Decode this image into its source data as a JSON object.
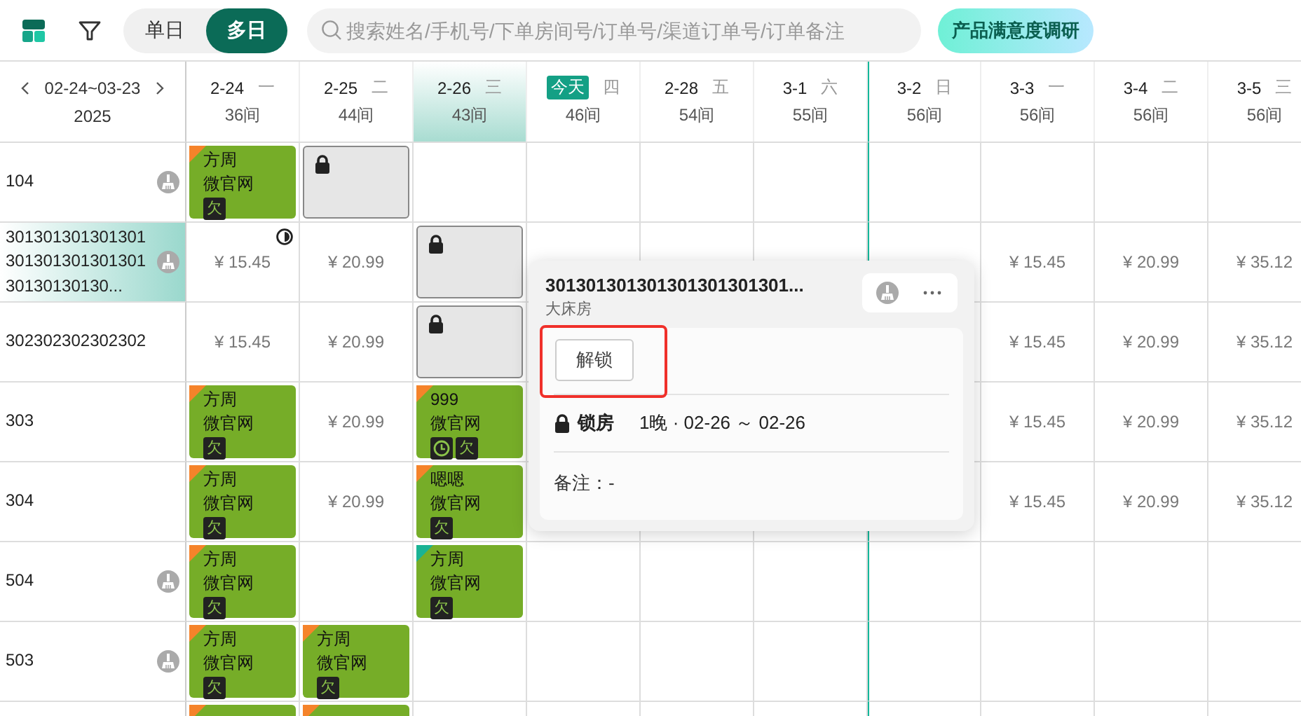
{
  "toolbar": {
    "view_modes": [
      {
        "label": "单日",
        "selected": false
      },
      {
        "label": "多日",
        "selected": true
      }
    ],
    "search": {
      "placeholder": "搜索姓名/手机号/下单房间号/订单号/渠道订单号/订单备注"
    },
    "survey_button": "产品满意度调研"
  },
  "date_range": {
    "range": "02-24~03-23",
    "year": "2025"
  },
  "dates": [
    {
      "date": "2-24",
      "weekday": "一",
      "count": "36间",
      "selected": false,
      "today": false,
      "marked": false
    },
    {
      "date": "2-25",
      "weekday": "二",
      "count": "44间",
      "selected": false,
      "today": false,
      "marked": false
    },
    {
      "date": "2-26",
      "weekday": "三",
      "count": "43间",
      "selected": true,
      "today": false,
      "marked": false
    },
    {
      "date": "今天",
      "weekday": "四",
      "count": "46间",
      "selected": false,
      "today": true,
      "marked": false
    },
    {
      "date": "2-28",
      "weekday": "五",
      "count": "54间",
      "selected": false,
      "today": false,
      "marked": false
    },
    {
      "date": "3-1",
      "weekday": "六",
      "count": "55间",
      "selected": false,
      "today": false,
      "marked": false
    },
    {
      "date": "3-2",
      "weekday": "日",
      "count": "56间",
      "selected": false,
      "today": false,
      "marked": true
    },
    {
      "date": "3-3",
      "weekday": "一",
      "count": "56间",
      "selected": false,
      "today": false,
      "marked": false
    },
    {
      "date": "3-4",
      "weekday": "二",
      "count": "56间",
      "selected": false,
      "today": false,
      "marked": false
    },
    {
      "date": "3-5",
      "weekday": "三",
      "count": "56间",
      "selected": false,
      "today": false,
      "marked": false
    }
  ],
  "rooms": [
    {
      "name": "104",
      "needs_cleaning": true,
      "selected": false,
      "cells": [
        {
          "kind": "booking",
          "guest": "方周",
          "channel": "微官网",
          "color": "#f5832a",
          "clock": false,
          "tag": "欠"
        },
        {
          "kind": "locked"
        },
        {
          "kind": "empty"
        },
        {
          "kind": "empty"
        },
        {
          "kind": "empty"
        },
        {
          "kind": "empty"
        },
        {
          "kind": "empty"
        },
        {
          "kind": "empty"
        },
        {
          "kind": "empty"
        },
        {
          "kind": "empty"
        }
      ]
    },
    {
      "name": "30130130130130130130130130130130130130130...",
      "needs_cleaning": true,
      "selected": true,
      "cells": [
        {
          "kind": "price",
          "price": "¥ 15.45",
          "badge": true
        },
        {
          "kind": "price",
          "price": "¥ 20.99",
          "badge": false
        },
        {
          "kind": "locked"
        },
        {
          "kind": "empty"
        },
        {
          "kind": "empty"
        },
        {
          "kind": "empty"
        },
        {
          "kind": "empty"
        },
        {
          "kind": "price",
          "price": "¥ 15.45",
          "badge": false
        },
        {
          "kind": "price",
          "price": "¥ 20.99",
          "badge": false
        },
        {
          "kind": "price",
          "price": "¥ 35.12",
          "badge": false
        }
      ]
    },
    {
      "name": "302302302302302",
      "needs_cleaning": false,
      "selected": false,
      "cells": [
        {
          "kind": "price",
          "price": "¥ 15.45",
          "badge": false
        },
        {
          "kind": "price",
          "price": "¥ 20.99",
          "badge": false
        },
        {
          "kind": "locked"
        },
        {
          "kind": "empty"
        },
        {
          "kind": "covered"
        },
        {
          "kind": "covered"
        },
        {
          "kind": "empty"
        },
        {
          "kind": "price",
          "price": "¥ 15.45",
          "badge": false
        },
        {
          "kind": "price",
          "price": "¥ 20.99",
          "badge": false
        },
        {
          "kind": "price",
          "price": "¥ 35.12",
          "badge": false
        }
      ]
    },
    {
      "name": "303",
      "needs_cleaning": false,
      "selected": false,
      "cells": [
        {
          "kind": "booking",
          "guest": "方周",
          "channel": "微官网",
          "color": "#f5832a",
          "clock": false,
          "tag": "欠"
        },
        {
          "kind": "price",
          "price": "¥ 20.99",
          "badge": false
        },
        {
          "kind": "booking",
          "guest": "999",
          "channel": "微官网",
          "color": "#f5832a",
          "clock": true,
          "tag": "欠"
        },
        {
          "kind": "empty"
        },
        {
          "kind": "covered"
        },
        {
          "kind": "covered"
        },
        {
          "kind": "empty"
        },
        {
          "kind": "price",
          "price": "¥ 15.45",
          "badge": false
        },
        {
          "kind": "price",
          "price": "¥ 20.99",
          "badge": false
        },
        {
          "kind": "price",
          "price": "¥ 35.12",
          "badge": false
        }
      ]
    },
    {
      "name": "304",
      "needs_cleaning": false,
      "selected": false,
      "cells": [
        {
          "kind": "booking",
          "guest": "方周",
          "channel": "微官网",
          "color": "#f5832a",
          "clock": false,
          "tag": "欠"
        },
        {
          "kind": "price",
          "price": "¥ 20.99",
          "badge": false
        },
        {
          "kind": "booking",
          "guest": "嗯嗯",
          "channel": "微官网",
          "color": "#f5832a",
          "clock": false,
          "tag": "欠"
        },
        {
          "kind": "empty"
        },
        {
          "kind": "empty"
        },
        {
          "kind": "empty"
        },
        {
          "kind": "empty"
        },
        {
          "kind": "price",
          "price": "¥ 15.45",
          "badge": false
        },
        {
          "kind": "price",
          "price": "¥ 20.99",
          "badge": false
        },
        {
          "kind": "price",
          "price": "¥ 35.12",
          "badge": false
        }
      ]
    },
    {
      "name": "504",
      "needs_cleaning": true,
      "selected": false,
      "cells": [
        {
          "kind": "booking",
          "guest": "方周",
          "channel": "微官网",
          "color": "#f5832a",
          "clock": false,
          "tag": "欠"
        },
        {
          "kind": "empty"
        },
        {
          "kind": "booking",
          "guest": "方周",
          "channel": "微官网",
          "color": "#1ab394",
          "clock": false,
          "tag": "欠"
        },
        {
          "kind": "empty"
        },
        {
          "kind": "empty"
        },
        {
          "kind": "empty"
        },
        {
          "kind": "empty"
        },
        {
          "kind": "empty"
        },
        {
          "kind": "empty"
        },
        {
          "kind": "empty"
        }
      ]
    },
    {
      "name": "503",
      "needs_cleaning": true,
      "selected": false,
      "cells": [
        {
          "kind": "booking",
          "guest": "方周",
          "channel": "微官网",
          "color": "#f5832a",
          "clock": false,
          "tag": "欠"
        },
        {
          "kind": "booking",
          "guest": "方周",
          "channel": "微官网",
          "color": "#f5832a",
          "clock": false,
          "tag": "欠"
        },
        {
          "kind": "empty"
        },
        {
          "kind": "empty"
        },
        {
          "kind": "empty"
        },
        {
          "kind": "empty"
        },
        {
          "kind": "empty"
        },
        {
          "kind": "empty"
        },
        {
          "kind": "empty"
        },
        {
          "kind": "empty"
        }
      ]
    },
    {
      "needs_cleaning": false,
      "selected": false,
      "cells": [
        {
          "kind": "booking",
          "color": "#f5832a",
          "clock": false
        },
        {
          "kind": "booking",
          "color": "#f5832a",
          "clock": false
        },
        {
          "kind": "empty"
        },
        {
          "kind": "empty"
        },
        {
          "kind": "empty"
        },
        {
          "kind": "empty"
        },
        {
          "kind": "empty"
        },
        {
          "kind": "empty"
        },
        {
          "kind": "empty"
        },
        {
          "kind": "empty"
        }
      ]
    }
  ],
  "popover": {
    "title": "301301301301301301301301...",
    "room_type": "大床房",
    "unlock_button": "解锁",
    "unlock_highlighted": true,
    "status": "锁房",
    "period": "1晚 · 02-26 ～ 02-26",
    "note": "备注：-"
  }
}
